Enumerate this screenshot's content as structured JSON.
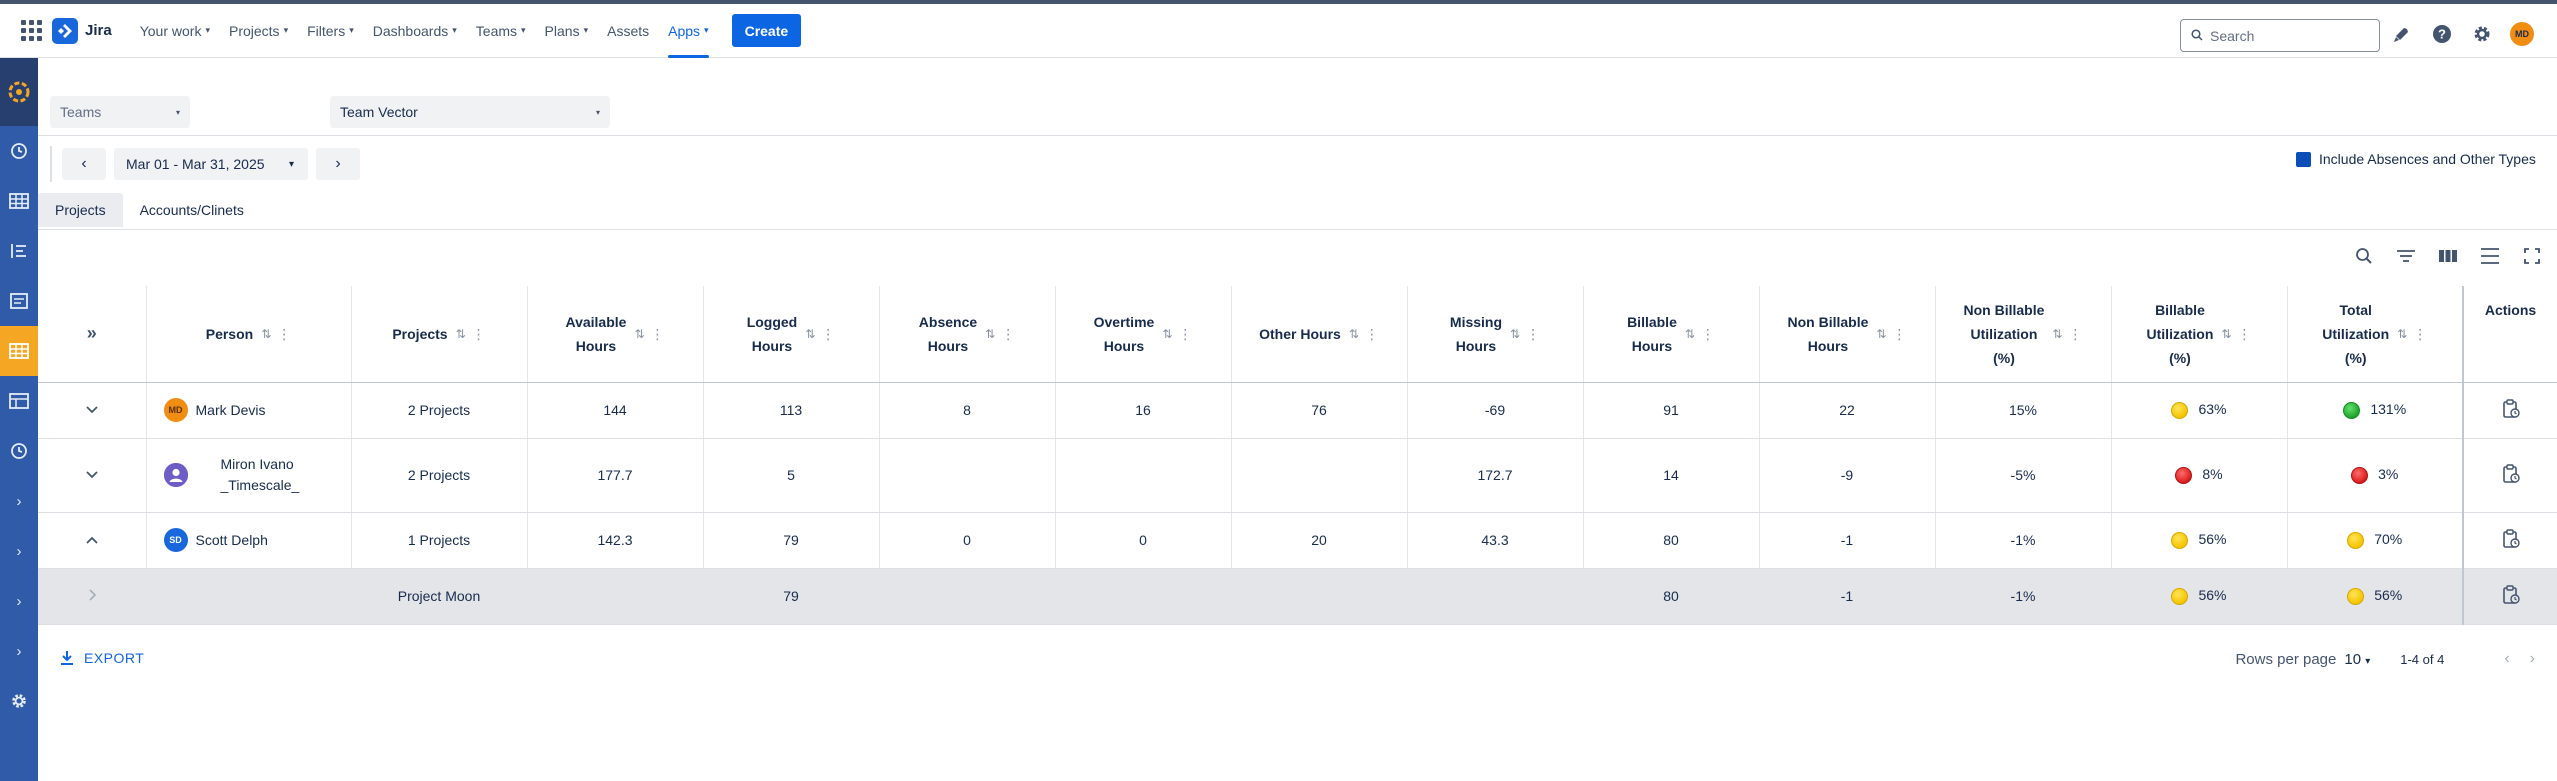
{
  "app": {
    "name": "Jira"
  },
  "nav": {
    "items": [
      {
        "label": "Your work",
        "chevron": true
      },
      {
        "label": "Projects",
        "chevron": true
      },
      {
        "label": "Filters",
        "chevron": true
      },
      {
        "label": "Dashboards",
        "chevron": true
      },
      {
        "label": "Teams",
        "chevron": true
      },
      {
        "label": "Plans",
        "chevron": true
      },
      {
        "label": "Assets",
        "chevron": false
      },
      {
        "label": "Apps",
        "chevron": true,
        "active": true
      }
    ],
    "create_label": "Create",
    "search_placeholder": "Search",
    "user_initials": "MD"
  },
  "filters": {
    "scope_select": "Teams",
    "team_select": "Team Vector",
    "date_range": "Mar 01 - Mar 31, 2025",
    "include_label": "Include Absences and Other Types",
    "include_checked": true
  },
  "tabs": [
    {
      "label": "Projects",
      "active": true
    },
    {
      "label": "Accounts/Clinets",
      "active": false
    }
  ],
  "table": {
    "columns": {
      "person": "Person",
      "projects": "Projects",
      "available": [
        "Available",
        "Hours"
      ],
      "logged": [
        "Logged",
        "Hours"
      ],
      "absence": [
        "Absence",
        "Hours"
      ],
      "overtime": [
        "Overtime",
        "Hours"
      ],
      "other": "Other Hours",
      "missing": [
        "Missing",
        "Hours"
      ],
      "billable": [
        "Billable",
        "Hours"
      ],
      "nonbillable": [
        "Non Billable",
        "Hours"
      ],
      "nbutil": [
        "Non Billable",
        "Utilization",
        "(%)"
      ],
      "butil": [
        "Billable",
        "Utilization",
        "(%)"
      ],
      "tutil": [
        "Total",
        "Utilization",
        "(%)"
      ],
      "actions": "Actions"
    },
    "rows": [
      {
        "initials": "MD",
        "name_1": "Mark Devis",
        "name_2": "",
        "projects": "2 Projects",
        "available": "144",
        "logged": "113",
        "absence": "8",
        "overtime": "16",
        "other": "76",
        "missing": "-69",
        "billable": "91",
        "nonbillable": "22",
        "nbutil": "15%",
        "butil": "63%",
        "tutil": "131%"
      },
      {
        "initials": "",
        "name_1": "Miron Ivano",
        "name_2": "_Timescale_",
        "projects": "2 Projects",
        "available": "177.7",
        "logged": "5",
        "absence": "",
        "overtime": "",
        "other": "",
        "missing": "172.7",
        "billable": "14",
        "nonbillable": "-9",
        "nbutil": "-5%",
        "butil": "8%",
        "tutil": "3%"
      },
      {
        "initials": "SD",
        "name_1": "Scott Delph",
        "name_2": "",
        "projects": "1 Projects",
        "available": "142.3",
        "logged": "79",
        "absence": "0",
        "overtime": "0",
        "other": "20",
        "missing": "43.3",
        "billable": "80",
        "nonbillable": "-1",
        "nbutil": "-1%",
        "butil": "56%",
        "tutil": "70%"
      },
      {
        "project": "Project Moon",
        "logged": "79",
        "billable": "80",
        "nonbillable": "-1",
        "nbutil": "-1%",
        "butil": "56%",
        "tutil": "56%"
      }
    ],
    "status_colors": {
      "yellow": "#f5c400",
      "green": "#1fa32b",
      "red": "#d91c1c"
    }
  },
  "footer": {
    "export_label": "EXPORT",
    "rows_per_page_label": "Rows per page",
    "rows_per_page_value": "10",
    "range_label": "1-4 of 4"
  }
}
